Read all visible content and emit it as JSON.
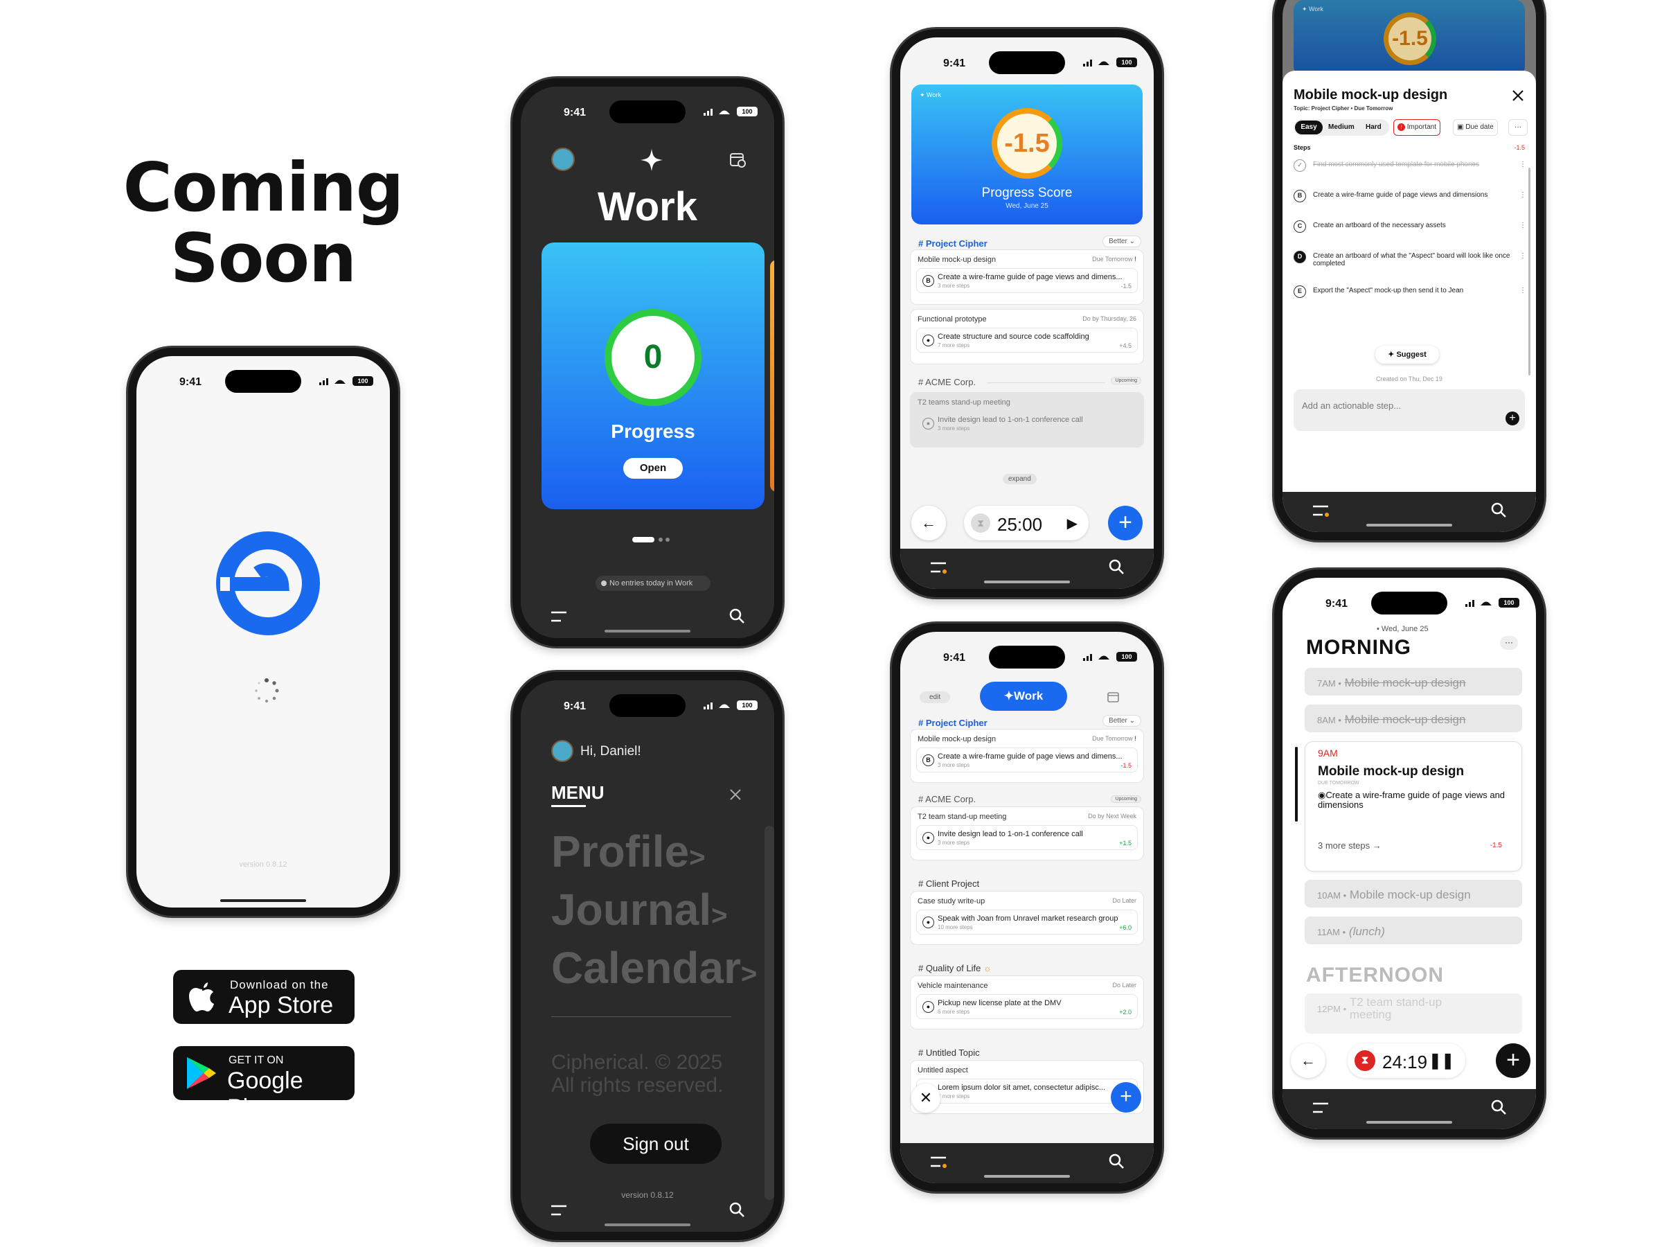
{
  "hero": {
    "line1": "Coming",
    "line2": "Soon"
  },
  "status": {
    "time": "9:41",
    "battery": "100"
  },
  "splash": {
    "version": "version 0.8.12"
  },
  "stores": {
    "apple_small": "Download on the",
    "apple_big": "App Store",
    "google_small": "GET IT ON",
    "google_big": "Google Play"
  },
  "work": {
    "title": "Work",
    "score": "0",
    "label": "Progress",
    "open": "Open",
    "empty": "No entries today in Work"
  },
  "menu": {
    "greeting": "Hi, Daniel!",
    "title": "MENU",
    "items": [
      "Profile",
      "Journal",
      "Calendar"
    ],
    "copyright1": "Cipherical. © 2025",
    "copyright2": "All rights reserved.",
    "signout": "Sign out",
    "version": "version 0.8.12"
  },
  "score": {
    "tag": "Work",
    "value": "-1.5",
    "title": "Progress Score",
    "date": "Wed, June 25",
    "topic1": "# Project Cipher",
    "better": "Better",
    "c1": {
      "title": "Mobile mock-up design",
      "due": "Due Tomorrow",
      "due_mark": "!",
      "badge": "B",
      "step": "Create a wire-frame guide of page views and dimens...",
      "more": "3 more steps",
      "delta": "-1.5"
    },
    "c2": {
      "title": "Functional prototype",
      "due": "Do by Thursday, 26",
      "step": "Create structure and source code scaffolding",
      "more": "7 more steps",
      "delta": "+4.5"
    },
    "topic2": "# ACME Corp.",
    "upcoming": "Upcoming",
    "c3": {
      "title": "T2 teams stand-up meeting",
      "step": "Invite design lead to 1-on-1 conference call",
      "more": "3 more steps"
    },
    "expand": "expand",
    "timer": "25:00"
  },
  "list": {
    "edit": "edit",
    "active": "Work",
    "topic1": "# Project Cipher",
    "better": "Better",
    "c1": {
      "title": "Mobile mock-up design",
      "due": "Due Tomorrow",
      "due_mark": "!",
      "badge": "B",
      "step": "Create a wire-frame guide of page views and dimens...",
      "more": "3 more steps",
      "delta": "-1.5"
    },
    "topic2": "# ACME Corp.",
    "upcoming": "Upcoming",
    "c2": {
      "title": "T2 team stand-up meeting",
      "due": "Do by Next Week",
      "step": "Invite design lead to 1-on-1 conference call",
      "more": "3 more steps",
      "delta": "+1.5"
    },
    "topic3": "# Client Project",
    "c3": {
      "title": "Case study write-up",
      "due": "Do Later",
      "step": "Speak with Joan from Unravel market research group",
      "more": "10 more steps",
      "delta": "+6.0"
    },
    "topic4": "# Quality of Life",
    "c4": {
      "title": "Vehicle maintenance",
      "due": "Do Later",
      "step": "Pickup new license plate at the DMV",
      "more": "6 more steps",
      "delta": "+2.0"
    },
    "topic5": "# Untitled Topic",
    "c5": {
      "title": "Untitled aspect",
      "step": "Lorem ipsum dolor sit amet, consectetur adipisc...",
      "more": "3 more steps"
    }
  },
  "detail": {
    "tag": "Work",
    "score": "-1.5",
    "title": "Mobile mock-up design",
    "sub": "Topic: Project Cipher • Due Tomorrow",
    "chips": [
      "Easy",
      "Medium",
      "Hard",
      "Important",
      "Due date",
      "···"
    ],
    "steps_label": "Steps",
    "steps_delta": "-1.5",
    "steps": [
      {
        "b": "",
        "t": "Find most commonly used template for mobile phones"
      },
      {
        "b": "B",
        "t": "Create a wire-frame guide of page views and dimensions"
      },
      {
        "b": "C",
        "t": "Create an artboard of the necessary assets"
      },
      {
        "b": "D",
        "t": "Create an artboard of what the \"Aspect\" board will look like once completed"
      },
      {
        "b": "E",
        "t": "Export the \"Aspect\" mock-up then send it to Jean"
      }
    ],
    "suggest": "Suggest",
    "created": "Created on Thu, Dec 19",
    "add": "Add an actionable step..."
  },
  "day": {
    "date": "• Wed, June 25",
    "morning": "MORNING",
    "s7": {
      "time": "7AM •",
      "text": "Mobile mock-up design"
    },
    "s8": {
      "time": "8AM •",
      "text": "Mobile mock-up design"
    },
    "s9": {
      "time": "9AM",
      "title": "Mobile mock-up design",
      "due": "DUE TOMORROW",
      "step": "Create a wire-frame guide of page views and dimensions",
      "more": "3 more steps →",
      "delta": "-1.5"
    },
    "s10": {
      "time": "10AM •",
      "text": "Mobile mock-up design"
    },
    "s11": {
      "time": "11AM •",
      "text": "(lunch)"
    },
    "afternoon": "AFTERNOON",
    "s12": {
      "time": "12PM •",
      "text": "T2 team stand-up meeting"
    },
    "timer": "24:19"
  },
  "colors": {
    "blue": "#1a6af0",
    "green": "#2ecc40",
    "orange": "#f39c12",
    "red": "#e02424"
  }
}
